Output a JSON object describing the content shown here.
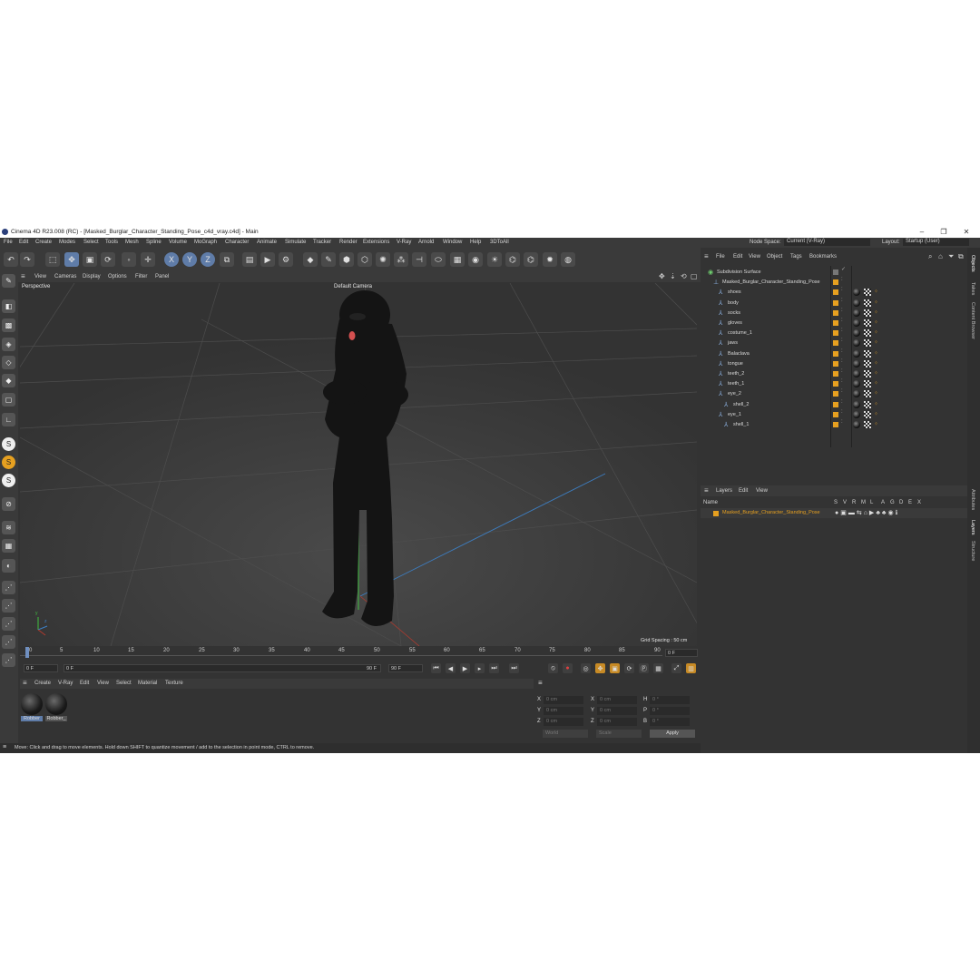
{
  "window": {
    "title": "Cinema 4D R23.008 (RC) - [Masked_Burglar_Character_Standing_Pose_c4d_vray.c4d] - Main",
    "minimize": "–",
    "maximize": "❐",
    "close": "✕"
  },
  "menubar": {
    "items": [
      "File",
      "Edit",
      "Create",
      "Modes",
      "Select",
      "Tools",
      "Mesh",
      "Spline",
      "Volume",
      "MoGraph",
      "Character",
      "Animate",
      "Simulate",
      "Tracker",
      "Render",
      "Extensions",
      "V-Ray",
      "Arnold",
      "Window",
      "Help",
      "3DToAll"
    ],
    "node_space_label": "Node Space:",
    "node_space_value": "Current (V-Ray)",
    "layout_label": "Layout:",
    "layout_value": "Startup (User)"
  },
  "toolbar": {
    "axis_x": "X",
    "axis_y": "Y",
    "axis_z": "Z"
  },
  "viewport": {
    "menu": [
      "View",
      "Cameras",
      "Display",
      "Options",
      "Filter",
      "Panel"
    ],
    "view_name": "Perspective",
    "camera": "Default Camera",
    "grid_spacing": "Grid Spacing : 50 cm",
    "axis_y": "y",
    "axis_z": "z"
  },
  "timeline": {
    "ticks": [
      "0",
      "5",
      "10",
      "15",
      "20",
      "25",
      "30",
      "35",
      "40",
      "45",
      "50",
      "55",
      "60",
      "65",
      "70",
      "75",
      "80",
      "85",
      "90"
    ],
    "current_frame_right": "0 F",
    "start_frame": "0 F",
    "preview_start": "0 F",
    "preview_end": "90 F",
    "end_frame": "90 F"
  },
  "material_manager": {
    "menu": [
      "Create",
      "V-Ray",
      "Edit",
      "View",
      "Select",
      "Material",
      "Texture"
    ],
    "materials": [
      {
        "name": "Robber"
      },
      {
        "name": "Robber_"
      }
    ]
  },
  "coordinates": {
    "labels_col1": [
      "X",
      "Y",
      "Z"
    ],
    "labels_col2": [
      "X",
      "Y",
      "Z"
    ],
    "labels_col3": [
      "H",
      "P",
      "B"
    ],
    "values_col1": [
      "0 cm",
      "0 cm",
      "0 cm"
    ],
    "values_col2": [
      "0 cm",
      "0 cm",
      "0 cm"
    ],
    "values_col3": [
      "0 °",
      "0 °",
      "0 °"
    ],
    "world": "World",
    "scale": "Scale",
    "apply": "Apply"
  },
  "status": {
    "text": "Move: Click and drag to move elements. Hold down SHIFT to quantize movement / add to the selection in point mode, CTRL to remove."
  },
  "object_manager": {
    "menu": [
      "File",
      "Edit",
      "View",
      "Object",
      "Tags",
      "Bookmarks"
    ],
    "objects": [
      {
        "name": "Subdivision Surface",
        "indent": 0
      },
      {
        "name": "Masked_Burglar_Character_Standing_Pose",
        "indent": 1
      },
      {
        "name": "shoes",
        "indent": 2
      },
      {
        "name": "body",
        "indent": 2
      },
      {
        "name": "socks",
        "indent": 2
      },
      {
        "name": "gloves",
        "indent": 2
      },
      {
        "name": "costume_1",
        "indent": 2
      },
      {
        "name": "jaws",
        "indent": 2
      },
      {
        "name": "Balaclava",
        "indent": 2
      },
      {
        "name": "tongue",
        "indent": 2
      },
      {
        "name": "teeth_2",
        "indent": 2
      },
      {
        "name": "teeth_1",
        "indent": 2
      },
      {
        "name": "eye_2",
        "indent": 2
      },
      {
        "name": "shell_2",
        "indent": 3
      },
      {
        "name": "eye_1",
        "indent": 2
      },
      {
        "name": "shell_1",
        "indent": 3
      }
    ]
  },
  "layer_manager": {
    "menu": [
      "Layers",
      "Edit",
      "View"
    ],
    "col_name": "Name",
    "col_flags": [
      "S",
      "V",
      "R",
      "M",
      "L",
      "A",
      "G",
      "D",
      "E",
      "X"
    ],
    "layers": [
      {
        "name": "Masked_Burglar_Character_Standing_Pose",
        "color": "#e6a020"
      }
    ]
  },
  "right_tabs": [
    "Objects",
    "Takes",
    "Content Browser",
    "Attributes",
    "Layers",
    "Structure"
  ],
  "colors": {
    "accent_orange": "#e6a020",
    "ui_bg": "#333333",
    "toolbar_blue": "#5f7ca8"
  }
}
